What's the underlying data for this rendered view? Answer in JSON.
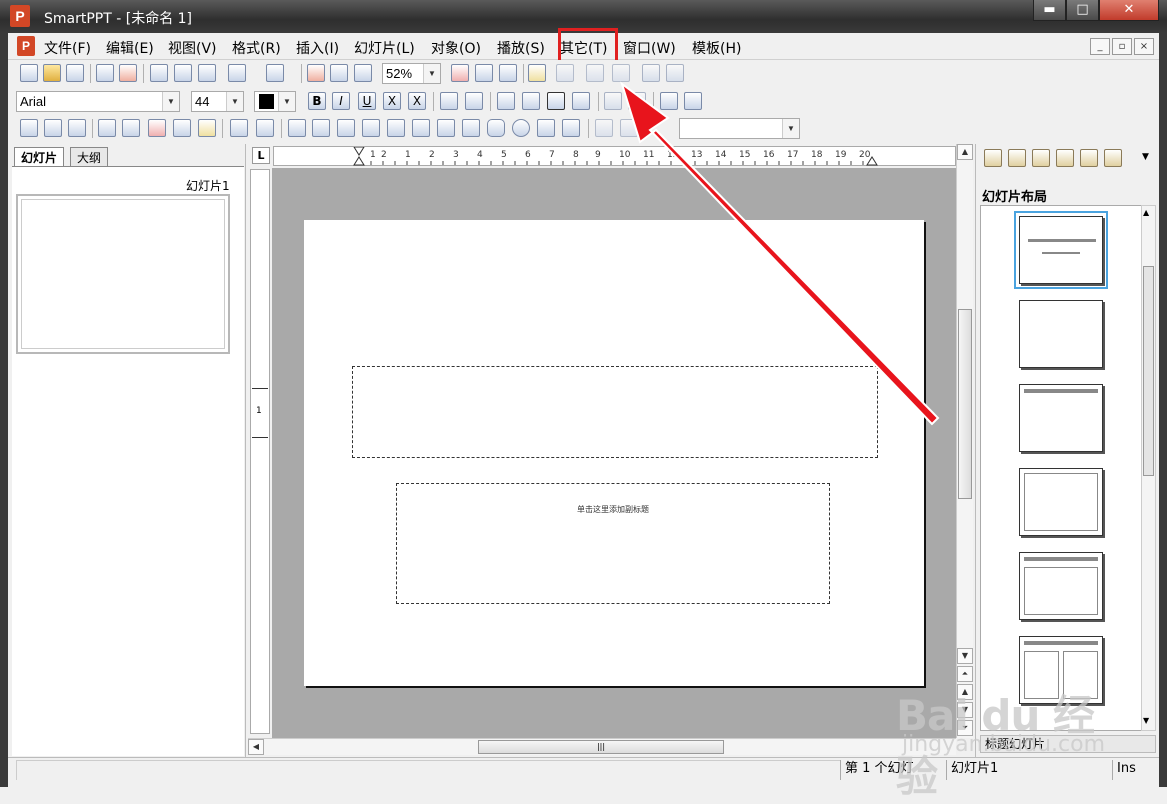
{
  "window": {
    "logo": "P",
    "title": "SmartPPT    - [未命名 1]",
    "min": "▬",
    "max": "□",
    "close": "✕"
  },
  "menu": {
    "logo": "P",
    "items": [
      "文件(F)",
      "编辑(E)",
      "视图(V)",
      "格式(R)",
      "插入(I)",
      "幻灯片(L)",
      "对象(O)",
      "播放(S)",
      "其它(T)",
      "窗口(W)",
      "模板(H)"
    ],
    "highlighted": "其它(T)",
    "mdi": [
      "_",
      "▫",
      "×"
    ]
  },
  "toolbar": {
    "zoom": "52%",
    "font_name": "Arial",
    "font_size": "44",
    "format_labels": [
      "B",
      "I",
      "U",
      "X",
      "X"
    ]
  },
  "left_panel": {
    "tabs": [
      "幻灯片",
      "大纲"
    ],
    "thumb_label": "幻灯片1"
  },
  "editor": {
    "corner": "L",
    "ruler_numbers": [
      "1",
      "2",
      "1",
      "2",
      "3",
      "4",
      "5",
      "6",
      "7",
      "8",
      "9",
      "10",
      "11",
      "12",
      "13",
      "14",
      "15",
      "16",
      "17",
      "18",
      "19",
      "20"
    ],
    "vruler_number": "1",
    "subtitle_placeholder": "单击这里添加副标题"
  },
  "right_panel": {
    "title": "幻灯片布局",
    "bottom_label": "标题幻灯片"
  },
  "status": {
    "slide_index": "第 1 个幻灯",
    "slide_name": "幻灯片1",
    "mode": "Ins"
  },
  "watermark": {
    "text": "Bai du 经验",
    "sub": "jingyan.baidu.com"
  },
  "colors": {
    "highlight": "#e02020",
    "arrow": "#e8141c",
    "brand": "#d24726"
  }
}
